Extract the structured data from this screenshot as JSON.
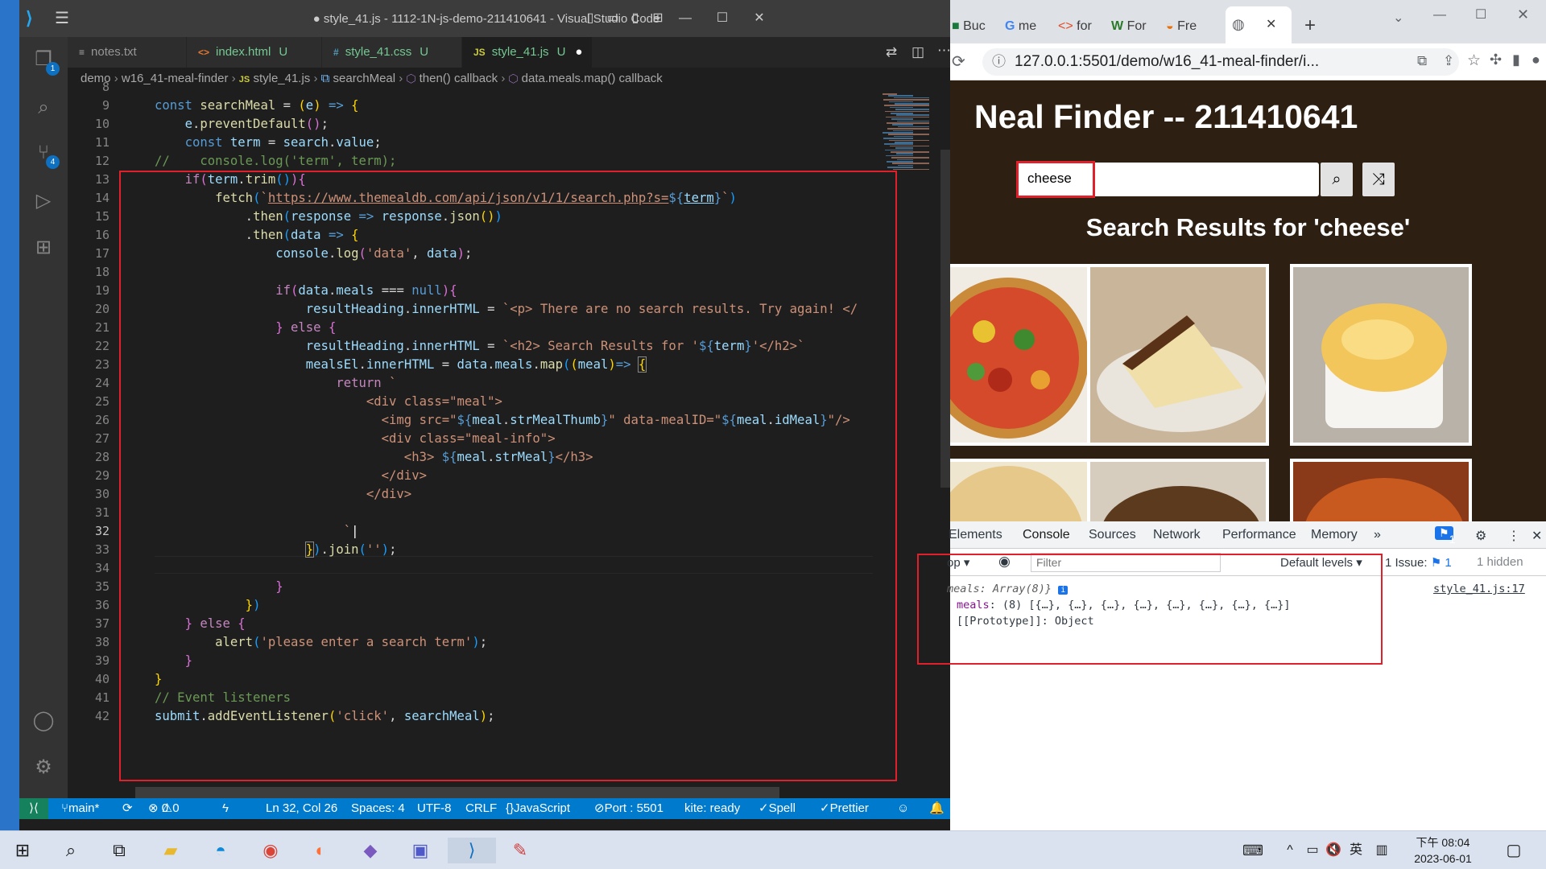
{
  "vscode": {
    "title": "● style_41.js - 1112-1N-js-demo-211410641 - Visual Studio Code",
    "tabs": [
      {
        "label": "notes.txt",
        "icon": "≡",
        "modified": "",
        "active": false
      },
      {
        "label": "index.html",
        "icon": "<>",
        "modified": "U",
        "active": false
      },
      {
        "label": "style_41.css",
        "icon": "#",
        "modified": "U",
        "active": false
      },
      {
        "label": "style_41.js",
        "icon": "JS",
        "modified": "U",
        "active": true
      }
    ],
    "activity_badges": {
      "explorer": "1",
      "scm": "4"
    },
    "breadcrumb": [
      "demo",
      "w16_41-meal-finder",
      "style_41.js",
      "searchMeal",
      "then() callback",
      "data.meals.map() callback"
    ],
    "line_numbers": [
      "8",
      "9",
      "10",
      "11",
      "12",
      "13",
      "14",
      "15",
      "16",
      "17",
      "18",
      "19",
      "20",
      "21",
      "22",
      "23",
      "24",
      "25",
      "26",
      "27",
      "28",
      "29",
      "30",
      "31",
      "32",
      "33",
      "34",
      "35",
      "36",
      "37",
      "38",
      "39",
      "40",
      "41",
      "42"
    ],
    "status": {
      "branch": "main*",
      "errors": "0",
      "warnings": "0",
      "position": "Ln 32, Col 26",
      "spaces": "Spaces: 4",
      "encoding": "UTF-8",
      "eol": "CRLF",
      "language": "JavaScript",
      "port": "Port : 5501",
      "kite": "kite: ready",
      "spell": "Spell",
      "prettier": "Prettier"
    }
  },
  "browser": {
    "tabs": [
      "Buc",
      "me",
      "for",
      "For",
      "Fre"
    ],
    "url": "127.0.0.1:5501/demo/w16_41-meal-finder/i...",
    "page": {
      "title": "Neal Finder -- 211410641",
      "search_value": "cheese",
      "result_heading": "Search Results for 'cheese'"
    },
    "devtools": {
      "tabs": [
        "Elements",
        "Console",
        "Sources",
        "Network",
        "Performance",
        "Memory"
      ],
      "issues_badge": "1",
      "filter_placeholder": "Filter",
      "levels": "Default levels",
      "issue_text": "1 Issue:",
      "issue_count": "1",
      "hidden": "1 hidden",
      "top_ctx": "op",
      "log_line1": "meals: Array(8)}",
      "log_source": "style_41.js:17",
      "log_line2_key": "meals",
      "log_line2_val": ": (8) [{…}, {…}, {…}, {…}, {…}, {…}, {…}, {…}]",
      "log_line3": "[[Prototype]]: Object"
    }
  },
  "taskbar": {
    "time": "下午 08:04",
    "date": "2023-06-01",
    "ime": "英"
  },
  "colors": {
    "vscode_status": "#007acc",
    "highlight": "#e0202a",
    "page_bg": "#2d2013"
  }
}
